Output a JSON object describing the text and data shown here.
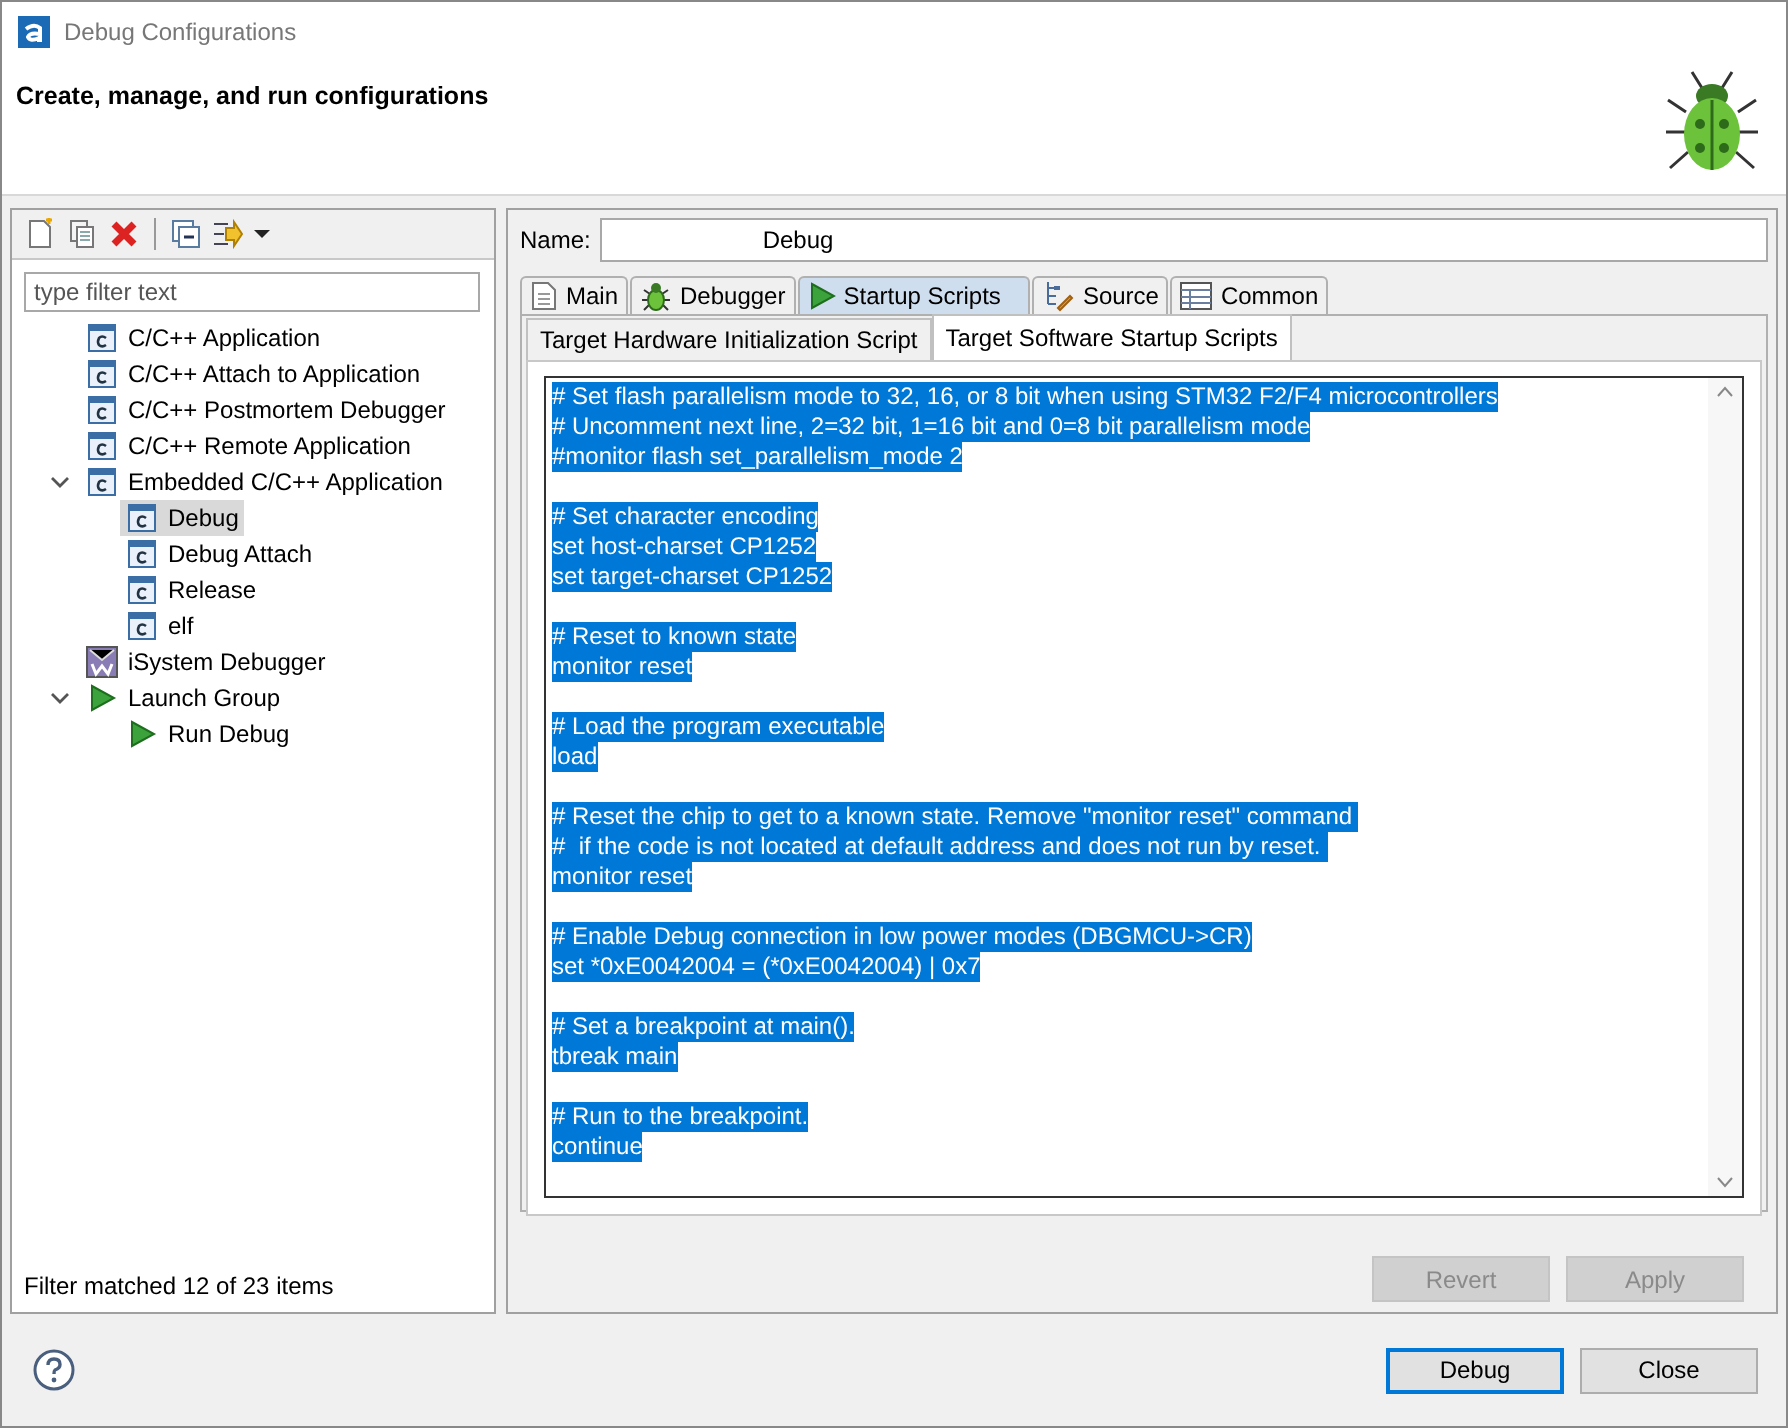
{
  "window": {
    "title": "Debug Configurations"
  },
  "header": {
    "title": "Create, manage, and run configurations"
  },
  "sidebar": {
    "filter": {
      "placeholder": "type filter text"
    },
    "tree": [
      {
        "label": "C/C++ Application",
        "kind": "c",
        "selected": false
      },
      {
        "label": "C/C++ Attach to Application",
        "kind": "c",
        "selected": false
      },
      {
        "label": "C/C++ Postmortem Debugger",
        "kind": "c",
        "selected": false
      },
      {
        "label": "C/C++ Remote Application",
        "kind": "c",
        "selected": false
      },
      {
        "label": "Embedded C/C++ Application",
        "kind": "c",
        "selected": false,
        "expanded": true,
        "children": [
          {
            "label": "Debug",
            "kind": "c",
            "selected": true
          },
          {
            "label": "Debug Attach",
            "kind": "c",
            "selected": false
          },
          {
            "label": "Release",
            "kind": "c",
            "selected": false
          },
          {
            "label": "elf",
            "kind": "c",
            "selected": false
          }
        ]
      },
      {
        "label": "iSystem Debugger",
        "kind": "isystem",
        "selected": false
      },
      {
        "label": "Launch Group",
        "kind": "launch",
        "selected": false,
        "expanded": true,
        "children": [
          {
            "label": "Run Debug",
            "kind": "launch",
            "selected": false
          }
        ]
      }
    ],
    "status": "Filter matched 12 of 23 items"
  },
  "name_field": {
    "label": "Name:",
    "value": "Debug"
  },
  "tabs": [
    {
      "label": "Main",
      "kind": "main",
      "selected": false
    },
    {
      "label": "Debugger",
      "kind": "debugger",
      "selected": false
    },
    {
      "label": "Startup Scripts",
      "kind": "startup",
      "selected": true
    },
    {
      "label": "Source",
      "kind": "source",
      "selected": false
    },
    {
      "label": "Common",
      "kind": "common",
      "selected": false
    }
  ],
  "subtabs": [
    {
      "label": "Target Hardware Initialization Script",
      "selected": false
    },
    {
      "label": "Target Software Startup Scripts",
      "selected": true
    }
  ],
  "script": {
    "selected": true,
    "blocks": [
      [
        "# Set flash parallelism mode to 32, 16, or 8 bit when using STM32 F2/F4 microcontrollers",
        "# Uncomment next line, 2=32 bit, 1=16 bit and 0=8 bit parallelism mode",
        "#monitor flash set_parallelism_mode 2"
      ],
      [
        "# Set character encoding",
        "set host-charset CP1252",
        "set target-charset CP1252"
      ],
      [
        "# Reset to known state",
        "monitor reset"
      ],
      [
        "# Load the program executable",
        "load"
      ],
      [
        "# Reset the chip to get to a known state. Remove \"monitor reset\" command ",
        "#  if the code is not located at default address and does not run by reset. ",
        "monitor reset"
      ],
      [
        "# Enable Debug connection in low power modes (DBGMCU->CR)",
        "set *0xE0042004 = (*0xE0042004) | 0x7"
      ],
      [
        "# Set a breakpoint at main().",
        "tbreak main"
      ],
      [
        "# Run to the breakpoint.",
        "continue"
      ]
    ]
  },
  "buttons": [
    {
      "label": "Revert",
      "disabled": true,
      "default": false
    },
    {
      "label": "Apply",
      "disabled": true,
      "default": false
    }
  ],
  "footer_buttons": [
    {
      "label": "Debug",
      "disabled": false,
      "default": true
    },
    {
      "label": "Close",
      "disabled": false,
      "default": false
    }
  ]
}
